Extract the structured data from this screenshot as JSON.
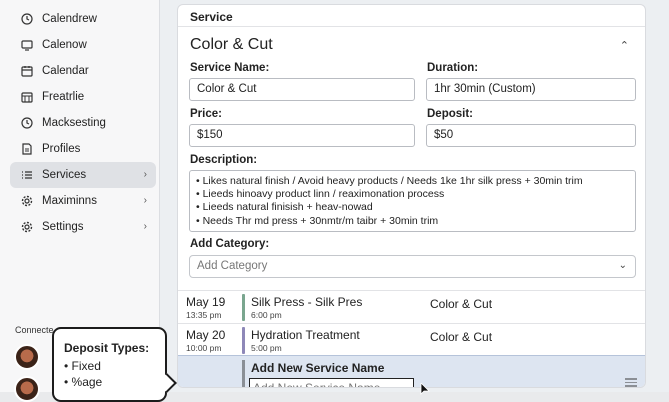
{
  "sidebar": {
    "items": [
      {
        "label": "Calendrew",
        "icon": "clock-icon"
      },
      {
        "label": "Calenow",
        "icon": "monitor-icon"
      },
      {
        "label": "Calendar",
        "icon": "calendar-icon"
      },
      {
        "label": "Freatrlie",
        "icon": "calendar-grid-icon"
      },
      {
        "label": "Macksesting",
        "icon": "clock-icon"
      },
      {
        "label": "Profiles",
        "icon": "document-icon"
      },
      {
        "label": "Services",
        "icon": "list-icon",
        "active": true
      },
      {
        "label": "Maximinns",
        "icon": "gear-icon"
      },
      {
        "label": "Settings",
        "icon": "gear-icon"
      }
    ],
    "connected_label": "Connecte"
  },
  "tooltip": {
    "title": "Deposit Types:",
    "lines": [
      "• Fixed",
      "• %age"
    ]
  },
  "panel": {
    "header": "Service",
    "service_title": "Color & Cut",
    "labels": {
      "name": "Service Name:",
      "duration": "Duration:",
      "price": "Price:",
      "deposit": "Deposit:",
      "description": "Description:",
      "category": "Add Category:"
    },
    "values": {
      "name": "Color & Cut",
      "duration": "1hr 30min (Custom)",
      "price": "$150",
      "deposit": "$50"
    },
    "description_lines": [
      "• Likes natural finish / Avoid heavy products / Needs 1ke 1hr silk press + 30min trim",
      "• Lieeds hinoavy product linn / reaximonation process",
      "• Lieeds natural finisish + heav-nowad",
      "• Needs Thr md press + 30nmtr/m taibr + 30min trim"
    ],
    "category_placeholder": "Add Category"
  },
  "appointments": [
    {
      "date": "May 19",
      "time": "13:35 pm",
      "service": "Silk Press - Silk Pres",
      "service_time": "6:00 pm",
      "category": "Color & Cut",
      "color": "#7aa68f"
    },
    {
      "date": "May 20",
      "time": "10:00 pm",
      "service": "Hydration Treatment",
      "service_time": "5:00 pm",
      "category": "Color & Cut",
      "color": "#8e88b8"
    }
  ],
  "add_new": {
    "label": "Add New Service Name",
    "placeholder": "Add New Service Name"
  }
}
